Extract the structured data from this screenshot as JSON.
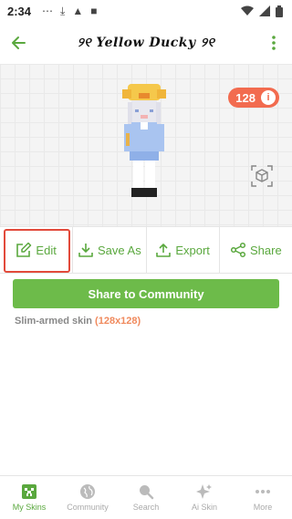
{
  "status": {
    "time": "2:34"
  },
  "header": {
    "title": "୨୧ Yellow Ducky ୨୧"
  },
  "preview": {
    "count": "128",
    "info": "i"
  },
  "actions": [
    {
      "label": "Edit"
    },
    {
      "label": "Save As"
    },
    {
      "label": "Export"
    },
    {
      "label": "Share"
    }
  ],
  "share_community": "Share to Community",
  "skin_info": {
    "type": "Slim-armed skin",
    "size": "(128x128)"
  },
  "nav": [
    {
      "label": "My Skins"
    },
    {
      "label": "Community"
    },
    {
      "label": "Search"
    },
    {
      "label": "Ai Skin"
    },
    {
      "label": "More"
    }
  ],
  "colors": {
    "accent": "#5aa83e",
    "badge": "#f26b4f",
    "highlight": "#e24a3b"
  }
}
